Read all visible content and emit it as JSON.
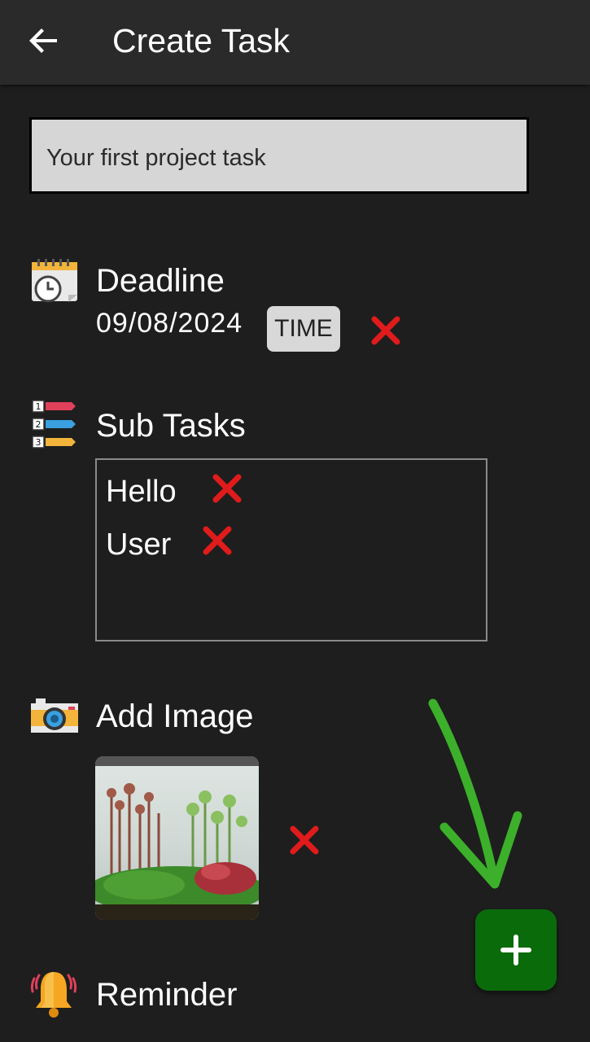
{
  "appbar": {
    "title": "Create Task",
    "back_icon": "arrow-left-icon"
  },
  "task_input": {
    "value": "Your first project task"
  },
  "deadline": {
    "label": "Deadline",
    "date": "09/08/2024",
    "time_button": "TIME",
    "icon": "calendar-clock-icon"
  },
  "subtasks": {
    "label": "Sub Tasks",
    "icon": "numbered-list-icon",
    "items": [
      {
        "text": "Hello"
      },
      {
        "text": "User"
      }
    ]
  },
  "image": {
    "label": "Add Image",
    "icon": "camera-icon"
  },
  "reminder": {
    "label": "Reminder",
    "icon": "bell-icon"
  },
  "fab": {
    "icon": "plus-icon"
  },
  "colors": {
    "background": "#1e1e1e",
    "appbar": "#2a2a2a",
    "fab": "#0a6b0a",
    "remove": "#e01b1b",
    "annotation_arrow": "#3cb02a"
  }
}
